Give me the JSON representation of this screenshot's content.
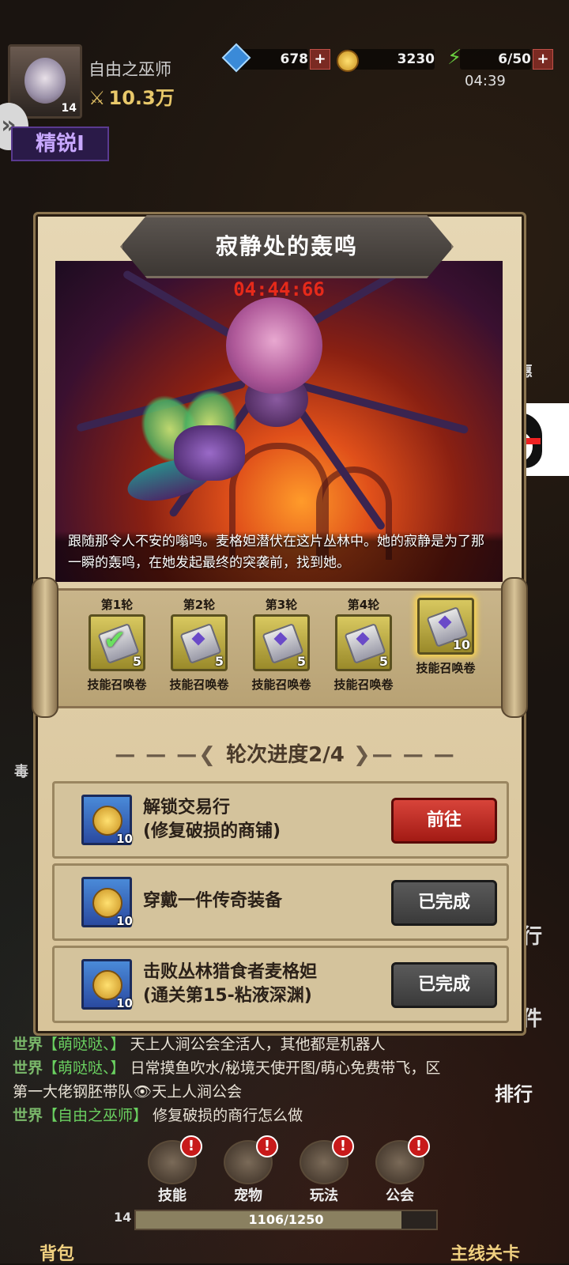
{
  "player": {
    "name": "自由之巫师",
    "level": "14",
    "power": "10.3万"
  },
  "resources": {
    "gems": "678",
    "gold": "3230",
    "energy": "6/50",
    "energy_timer": "04:39"
  },
  "badges": {
    "elite": "精锐Ⅰ"
  },
  "event": {
    "title": "寂静处的轰鸣",
    "timer": "04:44:66",
    "description": "跟随那令人不安的嗡鸣。麦格妲潜伏在这片丛林中。她的寂静是为了那一瞬的轰鸣，在她发起最终的突袭前，找到她。"
  },
  "rounds": [
    {
      "label": "第1轮",
      "item": "技能召唤卷",
      "count": "5",
      "claimed": true
    },
    {
      "label": "第2轮",
      "item": "技能召唤卷",
      "count": "5",
      "claimed": false
    },
    {
      "label": "第3轮",
      "item": "技能召唤卷",
      "count": "5",
      "claimed": false
    },
    {
      "label": "第4轮",
      "item": "技能召唤卷",
      "count": "5",
      "claimed": false
    },
    {
      "label": "",
      "item": "技能召唤卷",
      "count": "10",
      "claimed": false
    }
  ],
  "progress": {
    "label": "轮次进度2/4"
  },
  "tasks": [
    {
      "line1": "解锁交易行",
      "line2": "(修复破损的商铺)",
      "reward": "10",
      "button": "前往"
    },
    {
      "line1": "穿戴一件传奇装备",
      "line2": "",
      "reward": "10",
      "button": "已完成"
    },
    {
      "line1": "击败丛林猎食者麦格妲",
      "line2": "(通关第15-粘液深渊)",
      "reward": "10",
      "button": "已完成"
    }
  ],
  "chat": [
    {
      "channel": "世界",
      "name": "【萌哒哒、】",
      "text": "天上人涧公会全活人，其他都是机器人"
    },
    {
      "channel": "世界",
      "name": "【萌哒哒、】",
      "text": "日常摸鱼吹水/秘境天使开图/萌心免费带飞，区第一大佬钢胚带队👁天上人涧公会"
    },
    {
      "channel": "世界",
      "name": "【自由之巫师】",
      "text": "修复破损的商行怎么做"
    }
  ],
  "bottom_tabs": {
    "skill": "技能",
    "pet": "宠物",
    "play": "玩法",
    "guild": "公会",
    "bag": "背包",
    "mainline": "主线关卡",
    "rank": "排行"
  },
  "xp": {
    "level": "14",
    "value": "1106/1250",
    "fraction": 0.885
  },
  "side_labels": {
    "a": "行",
    "b": "件",
    "c": "毒",
    "d": "惠"
  }
}
